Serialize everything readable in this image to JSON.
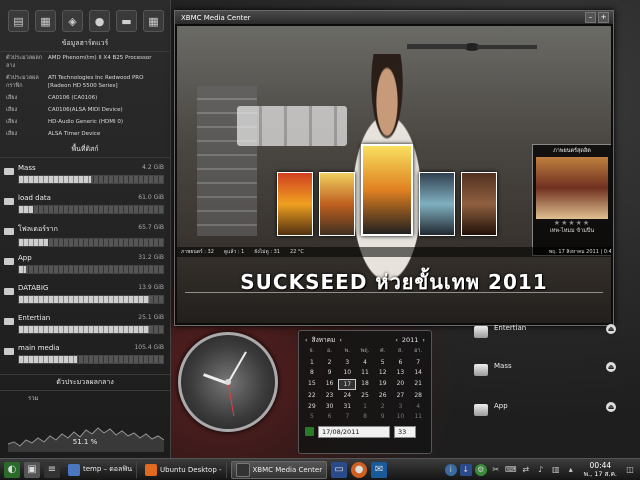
{
  "sidebar": {
    "hardware_title": "ข้อมูลฮาร์ดแวร์",
    "hardware": [
      {
        "key": "ตัวประมวลผลกลาง",
        "value": "AMD Phenom(tm) II X4 B25 Processor"
      },
      {
        "key": "ตัวประมวลผล กราฟิก",
        "value": "ATI Technologies Inc Redwood PRO [Radeon HD 5500 Series]"
      },
      {
        "key": "เสียง",
        "value": "CA0106 (CA0106)"
      },
      {
        "key": "เสียง",
        "value": "CA0106(ALSA MIDI Device)"
      },
      {
        "key": "เสียง",
        "value": "HD-Audio Generic (HDMI 0)"
      },
      {
        "key": "เสียง",
        "value": "ALSA Timer Device"
      }
    ],
    "disk_title": "พื้นที่ดิสก์",
    "disks": [
      {
        "name": "Mass",
        "size": "4.2 GiB",
        "used": 0.5
      },
      {
        "name": "load data",
        "size": "61.0 GiB",
        "used": 0.1
      },
      {
        "name": "โฟลเดอร์ราก",
        "size": "65.7 GiB",
        "used": 0.2
      },
      {
        "name": "App",
        "size": "31.2 GiB",
        "used": 0.05
      },
      {
        "name": "DATABIG",
        "size": "13.9 GiB",
        "used": 0.9
      },
      {
        "name": "Entertian",
        "size": "25.1 GiB",
        "used": 0.9
      },
      {
        "name": "main media",
        "size": "105.4 GiB",
        "used": 0.4
      }
    ],
    "cpu_title": "ตัวประมวลผลกลาง",
    "cpu_label": "รวม",
    "cpu_percent": "51.1 %"
  },
  "xbmc": {
    "window_title": "XBMC Media Center",
    "info_card_title": "ภาพยนตร์สุดฮิต",
    "info_card_stars": "★★★★★",
    "info_card_subtitle": "เทพ-ไหมม ข้ามปีน",
    "status_left": [
      "ภาพยนตร์ : 32",
      "ดูแล้ว : 1",
      "ยังไม่ดู : 31"
    ],
    "status_right": "พฤ. 17 สิงหาคม 2011  |  0:44",
    "weather": "22 °C",
    "movie_title": "SUCKSEED ห่วยขั้นเทพ 2011"
  },
  "calendar": {
    "month": "สิงหาคม",
    "year": "2011",
    "weekdays": [
      "จ.",
      "อ.",
      "พ.",
      "พฤ.",
      "ศ.",
      "ส.",
      "อา."
    ],
    "weeks": [
      [
        "30",
        "1",
        "2",
        "3",
        "4",
        "5",
        "6",
        "7"
      ],
      [
        "31",
        "8",
        "9",
        "10",
        "11",
        "12",
        "13",
        "14"
      ],
      [
        "32",
        "15",
        "16",
        "17",
        "18",
        "19",
        "20",
        "21"
      ],
      [
        "33",
        "22",
        "23",
        "24",
        "25",
        "26",
        "27",
        "28"
      ],
      [
        "34",
        "29",
        "30",
        "31",
        "1",
        "2",
        "3",
        "4"
      ],
      [
        "35",
        "5",
        "6",
        "7",
        "8",
        "9",
        "10",
        "11"
      ]
    ],
    "lead_weeks_header": [
      "30",
      "31",
      "32",
      "33",
      "34",
      "35"
    ],
    "today": "17",
    "date_value": "17/08/2011",
    "week_value": "33"
  },
  "devices": [
    {
      "label": "Entertian"
    },
    {
      "label": "Mass"
    },
    {
      "label": "App"
    }
  ],
  "taskbar": {
    "tasks": [
      {
        "label": "temp – ดอลฟิน"
      },
      {
        "label": "Ubuntu Desktop -"
      },
      {
        "label": "XBMC Media Center"
      }
    ],
    "time": "00:44",
    "date": "พ., 17 ส.ค."
  }
}
